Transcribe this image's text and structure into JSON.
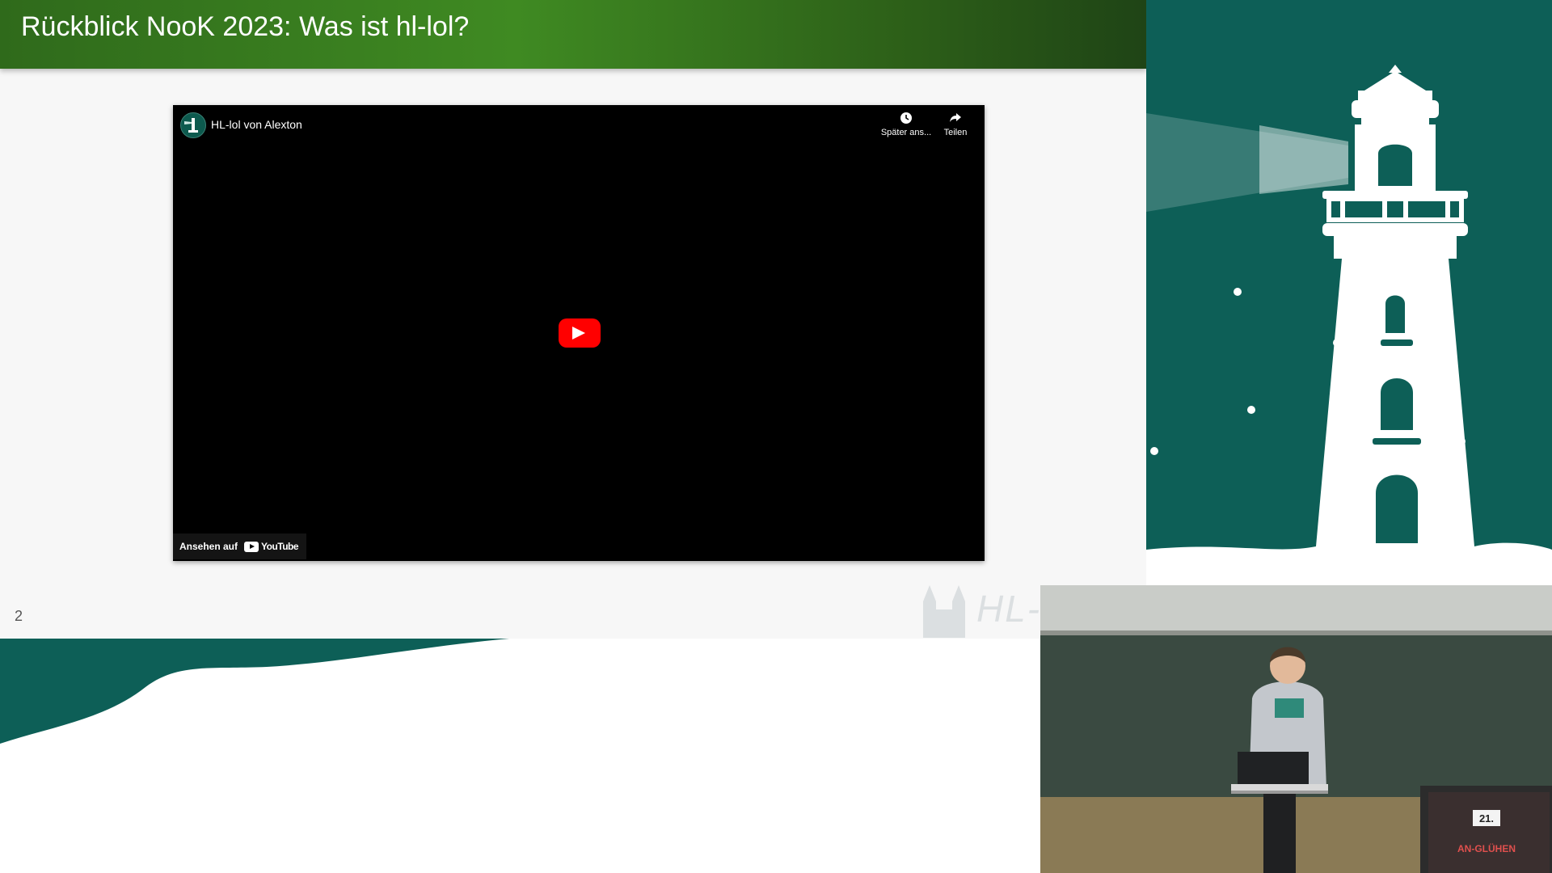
{
  "slide": {
    "title": "Rückblick NooK 2023: Was ist hl-lol?",
    "page_number": "2",
    "watermark": "HL-lol.de"
  },
  "video": {
    "title": "HL-lol von Alexton",
    "watch_later_label": "Später ans...",
    "share_label": "Teilen",
    "watch_on_label": "Ansehen auf",
    "youtube_label": "YouTube"
  },
  "camera": {
    "banner_number": "21.",
    "banner_text": "AN-GLÜHEN"
  },
  "colors": {
    "header_green": "#3f8a22",
    "teal": "#0d5f57",
    "youtube_red": "#ff0000"
  }
}
